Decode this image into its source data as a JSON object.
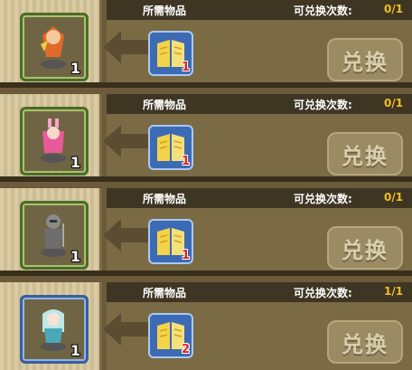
{
  "labels": {
    "required_items": "所需物品",
    "exchange_times": "可兑换次数:",
    "exchange_button": "兑换"
  },
  "rows": [
    {
      "reward_count": "1",
      "frame_color": "green",
      "item_qty": "1",
      "times": "0/1",
      "figure": "red-fox-figure-icon"
    },
    {
      "reward_count": "1",
      "frame_color": "green",
      "item_qty": "1",
      "times": "0/1",
      "figure": "pink-bunny-figure-icon"
    },
    {
      "reward_count": "1",
      "frame_color": "green",
      "item_qty": "1",
      "times": "0/1",
      "figure": "knight-figure-icon"
    },
    {
      "reward_count": "1",
      "frame_color": "blue",
      "item_qty": "2",
      "times": "1/1",
      "figure": "teal-girl-figure-icon"
    }
  ],
  "colors": {
    "times_value": "#f0c020",
    "qty": "#e02020",
    "green_frame": "#4d6b2a",
    "blue_frame": "#3a5f9a"
  }
}
